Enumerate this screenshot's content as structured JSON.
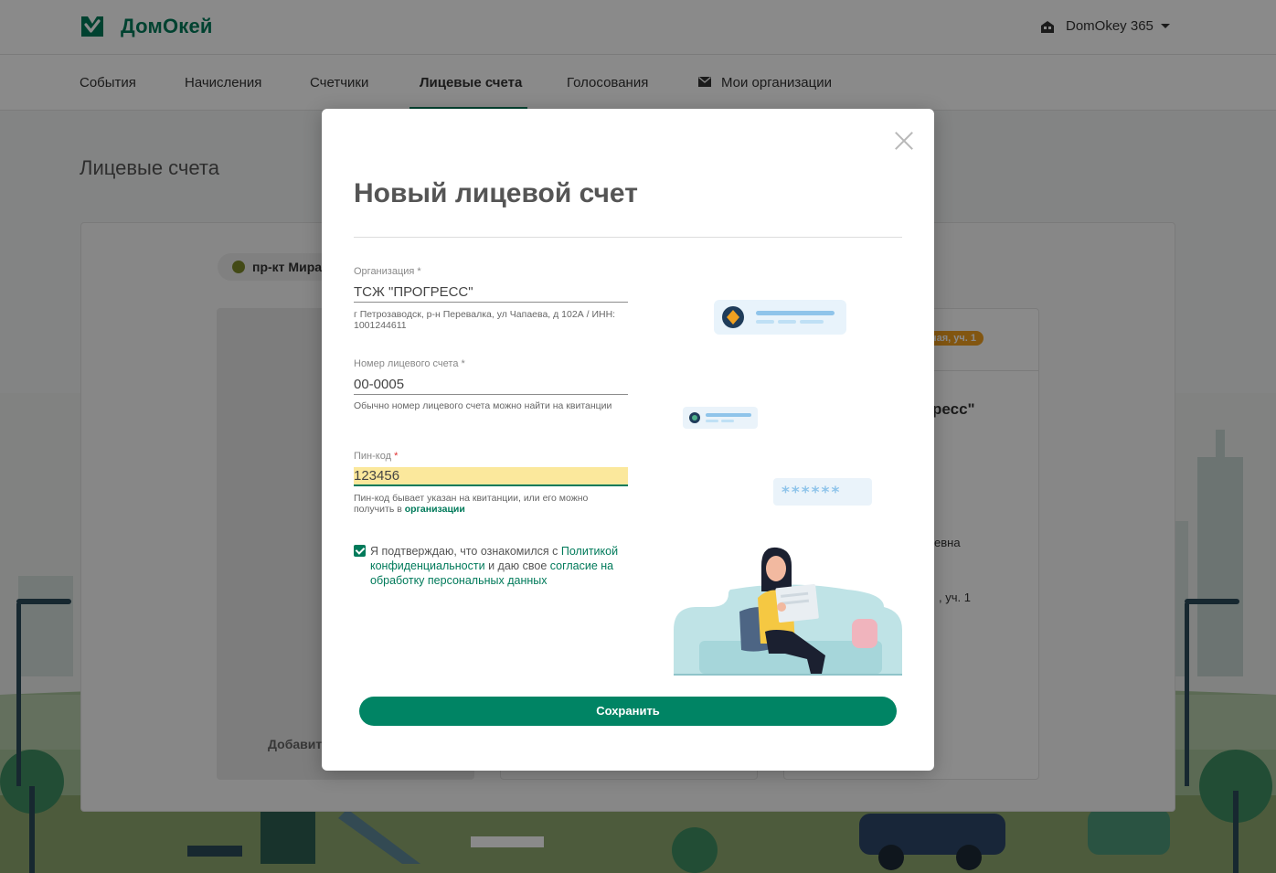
{
  "app": {
    "brand": "ДомОкей",
    "account_label": "DomOkey 365"
  },
  "nav": {
    "items": [
      {
        "label": "События"
      },
      {
        "label": "Начисления"
      },
      {
        "label": "Счетчики"
      },
      {
        "label": "Лицевые счета",
        "active": true
      },
      {
        "label": "Голосования"
      },
      {
        "label": "Мои организации"
      }
    ]
  },
  "background": {
    "page_title": "Лицевые счета",
    "address_chip": "пр-кт Мира",
    "add_label": "Добавит",
    "tag_label": "ная, уч. 1",
    "partial_org": "ресс\"",
    "partial_name": "евна",
    "partial_plot": ", уч. 1"
  },
  "modal": {
    "title": "Новый лицевой счет",
    "organization": {
      "label": "Организация",
      "required_mark": "*",
      "value": "ТСЖ \"ПРОГРЕСС\"",
      "hint": "г Петрозаводск, р-н Перевалка, ул Чапаева, д 102А / ИНН: 1001244611"
    },
    "account_number": {
      "label": "Номер лицевого счета",
      "required_mark": "*",
      "value": "00-0005",
      "hint": "Обычно номер лицевого счета можно найти на квитанции"
    },
    "pin": {
      "label": "Пин-код",
      "required_mark": "*",
      "value": "123456",
      "hint_text": "Пин-код бывает указан на квитанции, или его можно получить в",
      "hint_link": "организации"
    },
    "consent": {
      "checked": true,
      "text_1": "Я подтверждаю, что ознакомился с ",
      "link_1": "Политикой конфиденциальности",
      "text_2": " и даю свое ",
      "link_2": "согласие на обработку персональных данных"
    },
    "illustration_pin_mask": "******",
    "save_label": "Сохранить"
  },
  "colors": {
    "brand_green": "#007a5a",
    "button_green": "#008464",
    "pin_highlight": "#fbe89c",
    "tag_orange": "#f0a020"
  }
}
